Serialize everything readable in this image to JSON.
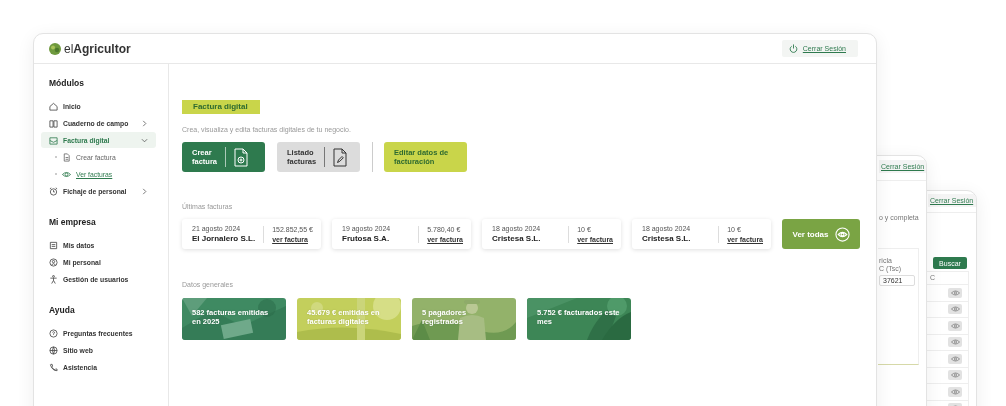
{
  "brand": {
    "light": "el",
    "bold": "Agricultor"
  },
  "header": {
    "logout": "Cerrar Sesión"
  },
  "sidebar": {
    "sections": [
      {
        "title": "Módulos",
        "items": [
          {
            "label": "Inicio",
            "selected": false
          },
          {
            "label": "Cuaderno de campo",
            "selected": false,
            "expanded": false
          },
          {
            "label": "Factura digital",
            "selected": true,
            "expanded": true,
            "children": [
              {
                "label": "Crear factura",
                "selected": false
              },
              {
                "label": "Ver facturas",
                "selected": true
              }
            ]
          },
          {
            "label": "Fichaje de personal",
            "selected": false,
            "expanded": false
          }
        ]
      },
      {
        "title": "Mi empresa",
        "items": [
          {
            "label": "Mis datos",
            "selected": false
          },
          {
            "label": "Mi personal",
            "selected": false
          },
          {
            "label": "Gestión de usuarios",
            "selected": false
          }
        ]
      },
      {
        "title": "Ayuda",
        "items": [
          {
            "label": "Preguntas frecuentes",
            "selected": false
          },
          {
            "label": "Sitio web",
            "selected": false
          },
          {
            "label": "Asistencia",
            "selected": false
          }
        ]
      }
    ]
  },
  "page": {
    "title": "Factura digital",
    "subtitle": "Crea, visualiza y edita facturas digitales de tu negocio.",
    "actions": [
      {
        "kind": "primary",
        "label": "Crear\nfactura"
      },
      {
        "kind": "secondary",
        "label": "Listado\nfacturas"
      },
      {
        "kind": "accent",
        "label": "Editar datos de\nfacturación"
      }
    ],
    "recent_title": "Últimas facturas",
    "invoices": [
      {
        "date": "21 agosto 2024",
        "company": "El Jornalero S.L.",
        "amount": "152.852,55 €",
        "link": "ver factura"
      },
      {
        "date": "19 agosto 2024",
        "company": "Frutosa S.A.",
        "amount": "5.780,40 €",
        "link": "ver factura"
      },
      {
        "date": "18 agosto 2024",
        "company": "Cristesa S.L.",
        "amount": "10 €",
        "link": "ver factura"
      },
      {
        "date": "18 agosto 2024",
        "company": "Cristesa S.L.",
        "amount": "10 €",
        "link": "ver factura"
      }
    ],
    "view_all": "Ver todas",
    "stats_title": "Datos generales",
    "stats": [
      {
        "text": "582 facturas emitidas en 2025",
        "color": "#3f8a62"
      },
      {
        "text": "45.679 € emitidas en facturas digitales",
        "color": "#c3cf5c"
      },
      {
        "text": "5 pagadores registrados",
        "color": "#93b26a"
      },
      {
        "text": "5.752 € facturados este mes",
        "color": "#3d8656"
      }
    ]
  },
  "back_windows": [
    {
      "logout": "Cerrar Sesión",
      "texts": [
        "o y completa",
        "ricla",
        "C (Tsc)"
      ],
      "field_value": "37621"
    },
    {
      "logout": "Cerrar Sesión",
      "button": "Buscar",
      "column": "C"
    }
  ]
}
